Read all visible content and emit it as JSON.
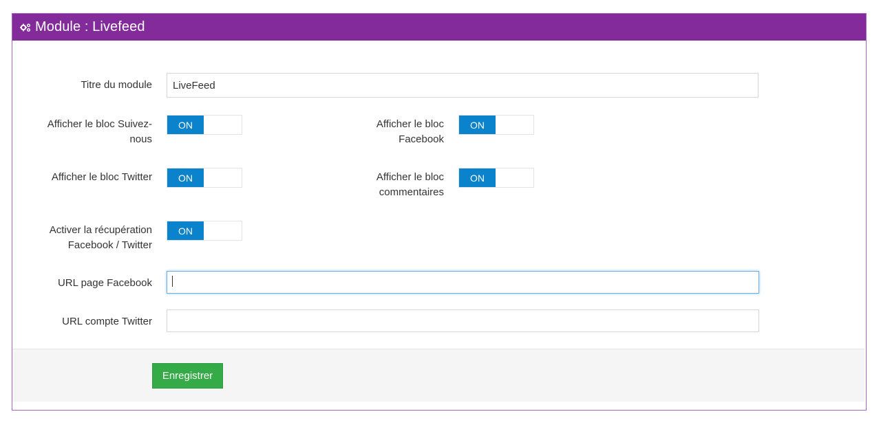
{
  "header": {
    "title": "Module : Livefeed",
    "icon": "cogs-icon"
  },
  "form": {
    "module_title": {
      "label": "Titre du module",
      "value": "LiveFeed"
    },
    "show_follow": {
      "label": "Afficher le bloc Suivez-nous",
      "state": "ON"
    },
    "show_facebook": {
      "label": "Afficher le bloc Facebook",
      "state": "ON"
    },
    "show_twitter": {
      "label": "Afficher le bloc Twitter",
      "state": "ON"
    },
    "show_comments": {
      "label": "Afficher le bloc commentaires",
      "state": "ON"
    },
    "enable_fetch": {
      "label": "Activer la récupération Facebook / Twitter",
      "state": "ON"
    },
    "facebook_url": {
      "label": "URL page Facebook",
      "value": ""
    },
    "twitter_url": {
      "label": "URL compte Twitter",
      "value": ""
    }
  },
  "footer": {
    "save_label": "Enregistrer"
  },
  "colors": {
    "header_bg": "#832b9b",
    "switch_on": "#0a82cc",
    "save_btn": "#35ab47"
  }
}
